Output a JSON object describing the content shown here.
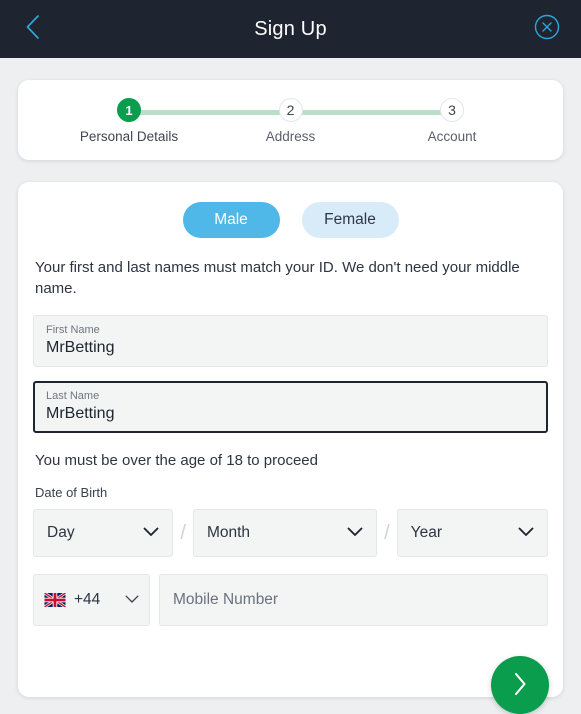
{
  "header": {
    "title": "Sign Up",
    "back_icon": "chevron-left-icon",
    "close_icon": "close-circle-icon"
  },
  "stepper": {
    "steps": [
      {
        "number": "1",
        "label": "Personal Details",
        "state": "active"
      },
      {
        "number": "2",
        "label": "Address",
        "state": "inactive"
      },
      {
        "number": "3",
        "label": "Account",
        "state": "inactive"
      }
    ],
    "active_color": "#0a9d4e",
    "line_color": "#b9dfc9"
  },
  "form": {
    "gender": {
      "selected": "Male",
      "options": [
        {
          "label": "Male",
          "state": "selected"
        },
        {
          "label": "Female",
          "state": "unselected"
        }
      ],
      "selected_color": "#4fb8e8",
      "unselected_color": "#d8ebf8"
    },
    "helper_text": "Your first and last names must match your ID. We don't need your middle name.",
    "first_name": {
      "label": "First Name",
      "value": "MrBetting"
    },
    "last_name": {
      "label": "Last Name",
      "value": "MrBetting",
      "focused": true
    },
    "age_notice": "You must be over the age of 18 to proceed",
    "dob": {
      "label": "Date of Birth",
      "day": {
        "value": "Day",
        "icon": "chevron-down-icon"
      },
      "month": {
        "value": "Month",
        "icon": "chevron-down-icon"
      },
      "year": {
        "value": "Year",
        "icon": "chevron-down-icon"
      },
      "separator": "/"
    },
    "phone": {
      "flag_icon": "uk-flag-icon",
      "dial_code": "+44",
      "dropdown_icon": "chevron-down-icon",
      "placeholder": "Mobile Number"
    },
    "next_button": {
      "icon": "chevron-right-icon",
      "color": "#0a9d4e"
    }
  }
}
